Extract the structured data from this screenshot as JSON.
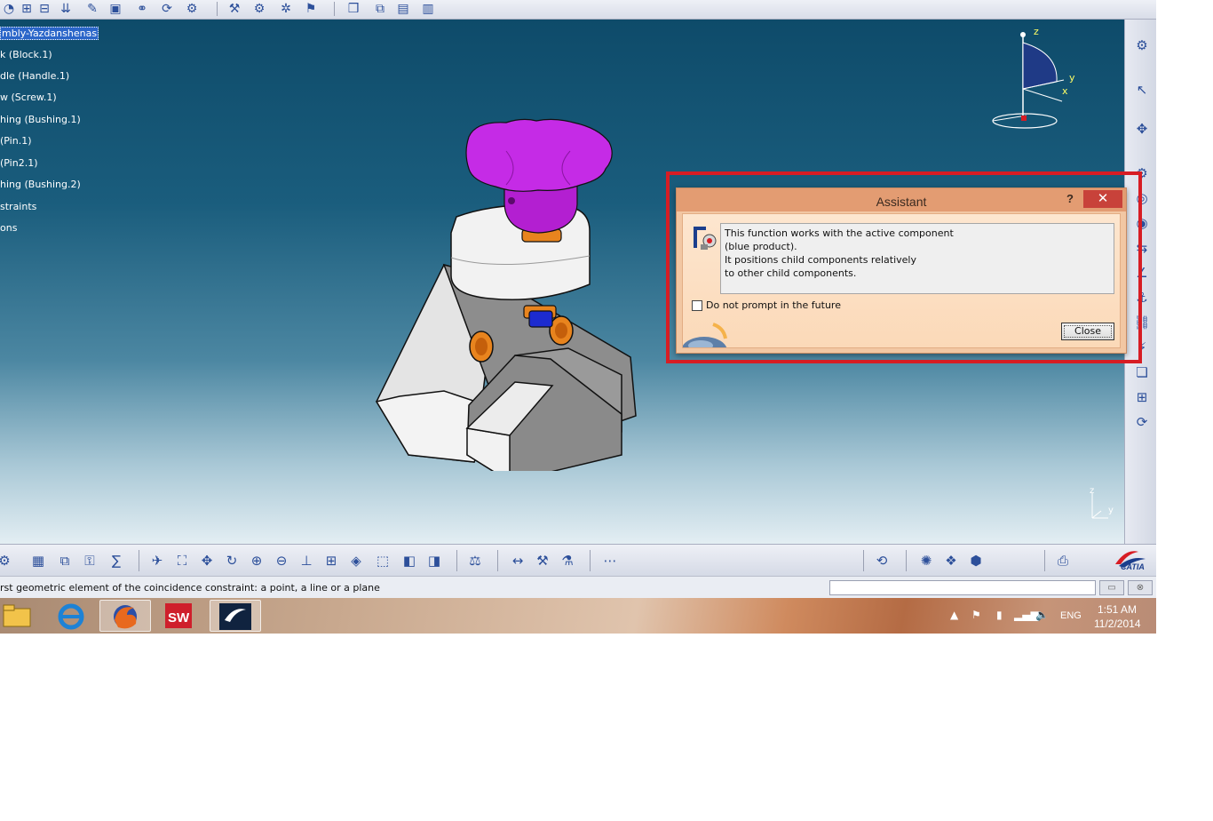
{
  "spec_tree": {
    "items": [
      {
        "label": "mbly-Yazdanshenas",
        "selected": true
      },
      {
        "label": "k (Block.1)"
      },
      {
        "label": "dle (Handle.1)"
      },
      {
        "label": "w (Screw.1)"
      },
      {
        "label": "hing (Bushing.1)"
      },
      {
        "label": "(Pin.1)"
      },
      {
        "label": " (Pin2.1)"
      },
      {
        "label": "hing (Bushing.2)"
      },
      {
        "label": "straints"
      },
      {
        "label": "ons"
      }
    ]
  },
  "compass": {
    "z_label": "z",
    "y_label": "y",
    "x_label": "x"
  },
  "mini_axis": {
    "z_label": "z",
    "y_label": "y"
  },
  "assistant": {
    "title": "Assistant",
    "help_label": "?",
    "close_x": "✕",
    "message_lines": [
      "This function works with the active component",
      "(blue product).",
      "It positions child components relatively",
      "to other child components."
    ],
    "checkbox_label": "Do not prompt in the future",
    "checkbox_checked": false,
    "close_button": "Close"
  },
  "status_bar": {
    "message": "rst geometric element of the coincidence constraint: a point, a line or a plane",
    "command_value": ""
  },
  "branding": {
    "catia_label": "CATIA"
  },
  "taskbar": {
    "apps": [
      "file-explorer",
      "internet-explorer",
      "firefox",
      "solidworks",
      "catia"
    ],
    "language": "ENG",
    "time": "1:51 AM",
    "date": "11/2/2014"
  },
  "colors": {
    "highlight_frame": "#d71d24",
    "handle_knob": "#b31fd1",
    "dialog_title_bar": "#e39c72",
    "viewport_top": "#0e4b6a"
  }
}
